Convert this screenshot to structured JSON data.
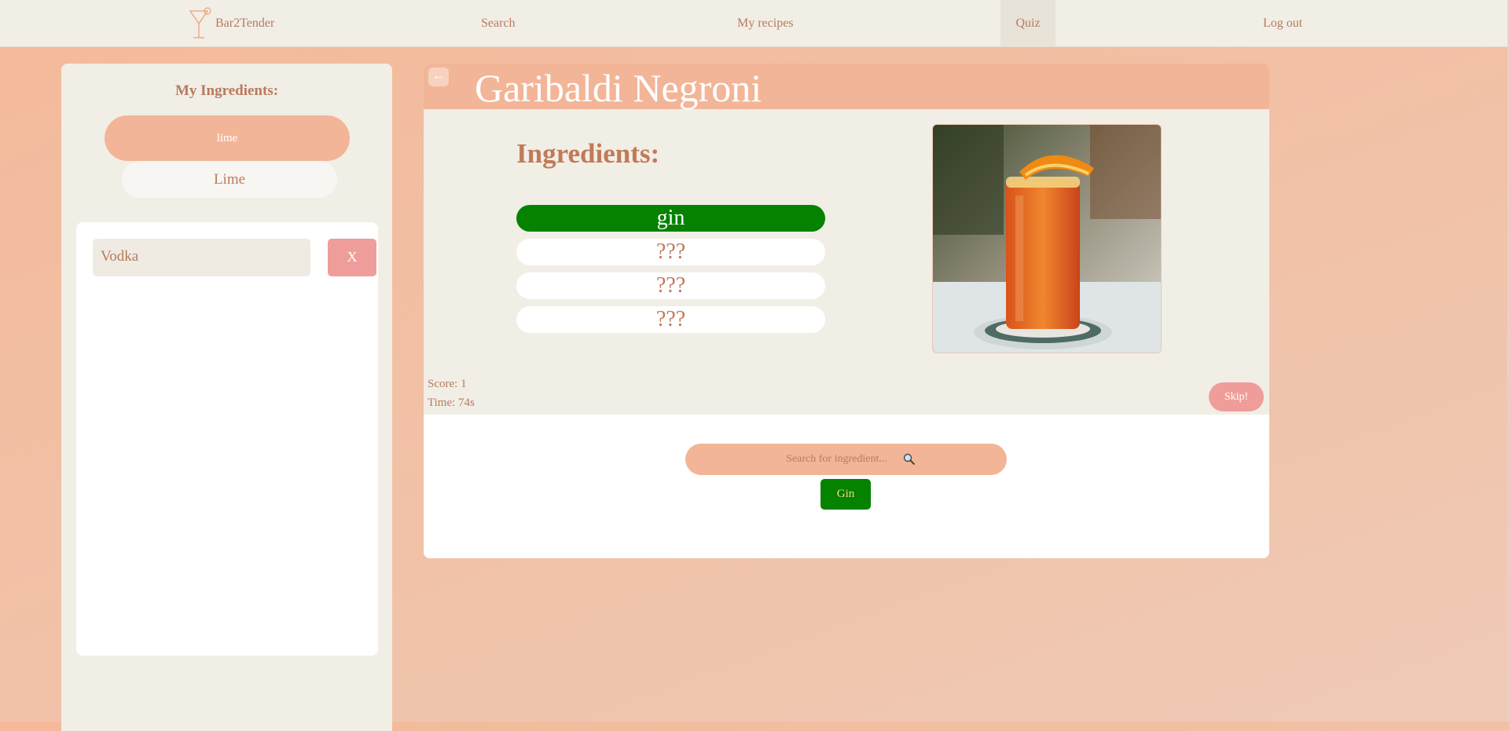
{
  "nav": {
    "brand": "Bar2Tender",
    "search": "Search",
    "my_recipes": "My recipes",
    "quiz": "Quiz",
    "logout": "Log out"
  },
  "sidebar": {
    "title": "My Ingredients:",
    "selected_pill": "lime",
    "suggestion_pill": "Lime",
    "list": [
      {
        "name": "Vodka",
        "remove_label": "X"
      }
    ]
  },
  "quiz": {
    "back_label": "←",
    "recipe_title": "Garibaldi Negroni",
    "ingredients_heading": "Ingredients:",
    "ingredients": [
      {
        "label": "gin",
        "state": "found"
      },
      {
        "label": "???",
        "state": "hidden"
      },
      {
        "label": "???",
        "state": "hidden"
      },
      {
        "label": "???",
        "state": "hidden"
      }
    ],
    "score_text": "Score: 1",
    "time_text": "Time: 74s",
    "skip_label": "Skip!",
    "search_placeholder": "Search for ingredient...",
    "search_suggestion": "Gin"
  },
  "colors": {
    "accent": "#f3b597",
    "found": "#048200",
    "skip": "#ef9d9a",
    "text": "#c17a57"
  }
}
